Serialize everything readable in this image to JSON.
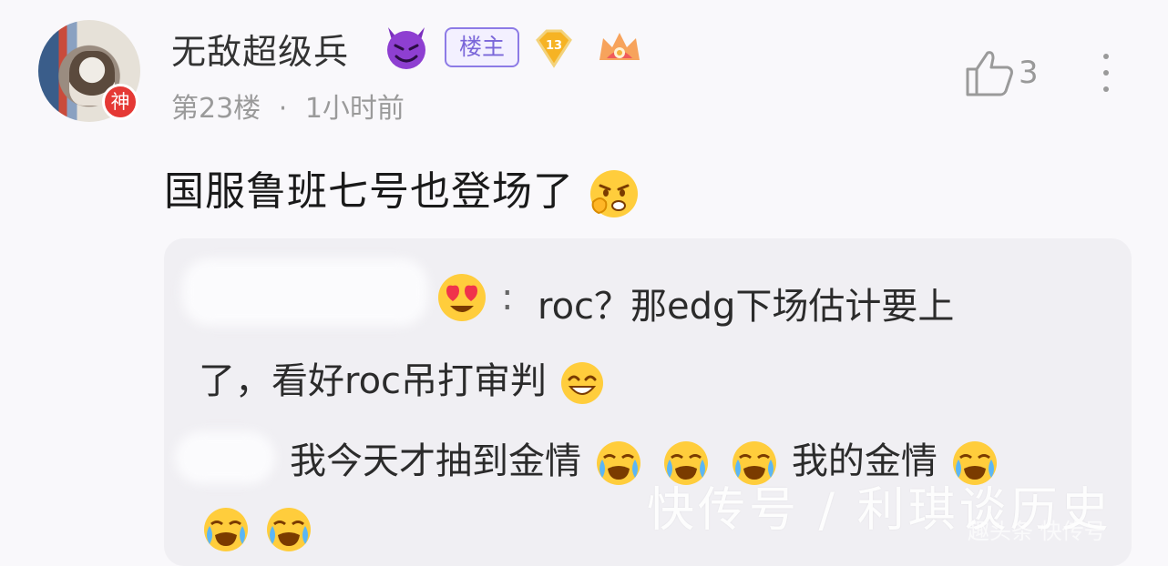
{
  "user": {
    "name": "无敌超级兵",
    "god_badge": "神",
    "owner_tag": "楼主",
    "level": "13"
  },
  "post": {
    "floor": "第23楼",
    "separator": "·",
    "time": "1小时前",
    "likes": "3",
    "content": "国服鲁班七号也登场了"
  },
  "quote": {
    "reply1_line1": "roc？那edg下场估计要上",
    "reply1_line2": "了，看好roc吊打审判",
    "reply2_part1": "我今天才抽到金情",
    "reply2_part2": "我的金情",
    "colon": ":"
  },
  "watermark": {
    "main": "快传号 / 利琪谈历史",
    "sub": "趣头条 快传号"
  },
  "icons": {
    "devil": "devil-emoji-icon",
    "level": "level-diamond-icon",
    "rank": "rank-crown-icon",
    "like": "thumb-up-icon",
    "more": "more-vertical-icon",
    "smirk": "sly-face-emoji-icon",
    "heart_eyes": "heart-eyes-emoji-icon",
    "laugh": "laughing-emoji-icon",
    "cry": "crying-emoji-icon"
  },
  "colors": {
    "owner_tag": "#7a66d9",
    "god_badge": "#e53935",
    "meta_text": "#9a9a9a",
    "quote_bg": "#f0eff3"
  }
}
